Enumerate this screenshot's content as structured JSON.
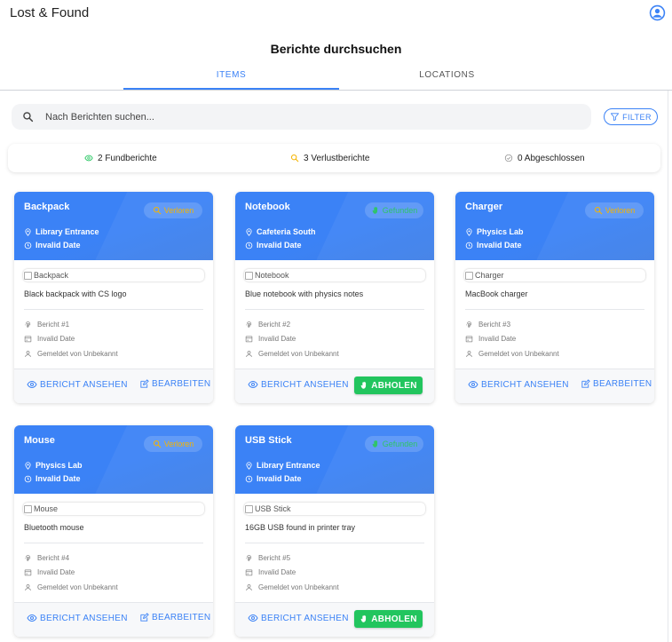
{
  "app": {
    "title": "Lost & Found"
  },
  "page": {
    "title": "Berichte durchsuchen"
  },
  "tabs": [
    {
      "label": "ITEMS",
      "active": true
    },
    {
      "label": "LOCATIONS",
      "active": false
    }
  ],
  "search": {
    "placeholder": "Nach Berichten suchen...",
    "value": ""
  },
  "filter": {
    "label": "FILTER"
  },
  "stats": {
    "found": "2 Fundberichte",
    "lost": "3 Verlustberichte",
    "closed": "0 Abgeschlossen"
  },
  "colors": {
    "accent": "#3b82f6",
    "lost": "#f5b400",
    "found": "#22c55e"
  },
  "actions": {
    "view": "BERICHT ANSEHEN",
    "edit": "BEARBEITEN",
    "pickup": "ABHOLEN"
  },
  "cards": [
    {
      "title": "Backpack",
      "status": "Verloren",
      "location": "Library Entrance",
      "date": "Invalid Date",
      "image_alt": "Backpack",
      "description": "Black backpack with CS logo",
      "report": "Bericht #1",
      "report_date": "Invalid Date",
      "reporter": "Gemeldet von Unbekannt"
    },
    {
      "title": "Notebook",
      "status": "Gefunden",
      "location": "Cafeteria South",
      "date": "Invalid Date",
      "image_alt": "Notebook",
      "description": "Blue notebook with physics notes",
      "report": "Bericht #2",
      "report_date": "Invalid Date",
      "reporter": "Gemeldet von Unbekannt"
    },
    {
      "title": "Charger",
      "status": "Verloren",
      "location": "Physics Lab",
      "date": "Invalid Date",
      "image_alt": "Charger",
      "description": "MacBook charger",
      "report": "Bericht #3",
      "report_date": "Invalid Date",
      "reporter": "Gemeldet von Unbekannt"
    },
    {
      "title": "Mouse",
      "status": "Verloren",
      "location": "Physics Lab",
      "date": "Invalid Date",
      "image_alt": "Mouse",
      "description": "Bluetooth mouse",
      "report": "Bericht #4",
      "report_date": "Invalid Date",
      "reporter": "Gemeldet von Unbekannt"
    },
    {
      "title": "USB Stick",
      "status": "Gefunden",
      "location": "Library Entrance",
      "date": "Invalid Date",
      "image_alt": "USB Stick",
      "description": "16GB USB found in printer tray",
      "report": "Bericht #5",
      "report_date": "Invalid Date",
      "reporter": "Gemeldet von Unbekannt"
    }
  ]
}
